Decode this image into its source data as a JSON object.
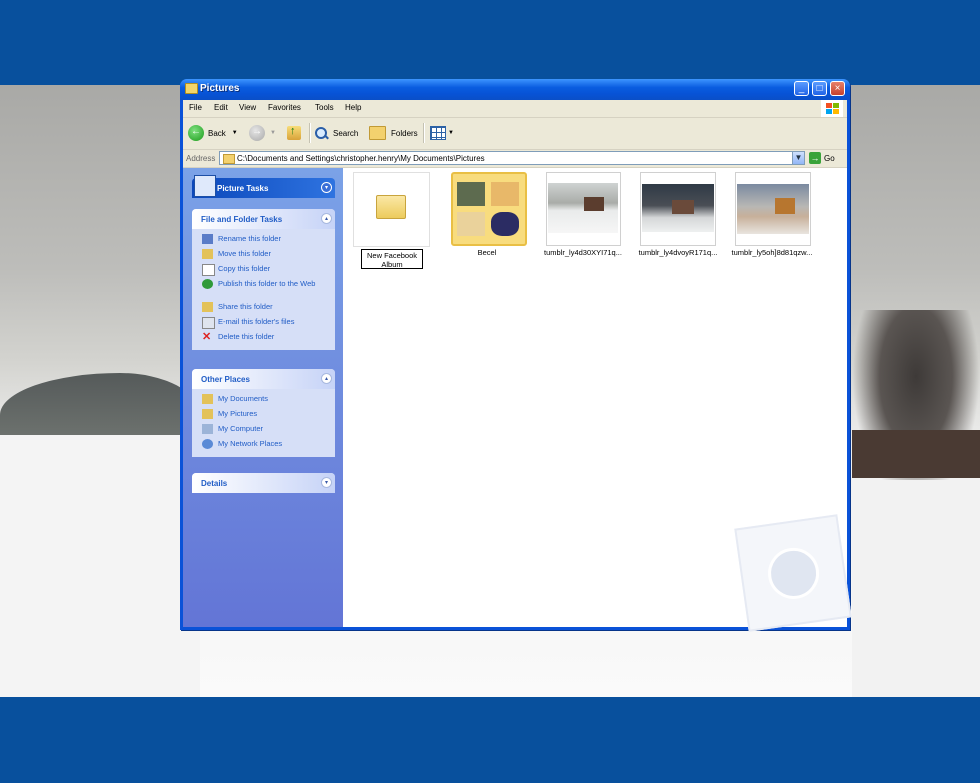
{
  "window": {
    "title": "Pictures",
    "buttons": [
      "_",
      "□",
      "×"
    ]
  },
  "menubar": [
    "File",
    "Edit",
    "View",
    "Favorites",
    "Tools",
    "Help"
  ],
  "toolbar": {
    "back": "Back",
    "search": "Search",
    "folders": "Folders"
  },
  "address": {
    "label": "Address",
    "path": "C:\\Documents and Settings\\christopher.henry\\My Documents\\Pictures",
    "go": "Go"
  },
  "taskpane": {
    "picture_tasks": {
      "title": "Picture Tasks"
    },
    "file_folder_tasks": {
      "title": "File and Folder Tasks",
      "items": [
        "Rename this folder",
        "Move this folder",
        "Copy this folder",
        "Publish this folder to the Web",
        "Share this folder",
        "E-mail this folder's files",
        "Delete this folder"
      ]
    },
    "other_places": {
      "title": "Other Places",
      "items": [
        "My Documents",
        "My Pictures",
        "My Computer",
        "My Network Places"
      ]
    },
    "details": {
      "title": "Details"
    }
  },
  "files": [
    {
      "name": "New Facebook Album",
      "type": "folder",
      "renaming": true
    },
    {
      "name": "Becel",
      "type": "folder",
      "selected": true
    },
    {
      "name": "tumblr_ly4d30XYI71q...",
      "type": "image"
    },
    {
      "name": "tumblr_ly4dvoyR171q...",
      "type": "image"
    },
    {
      "name": "tumblr_ly5oh]8d81qzw...",
      "type": "image"
    }
  ]
}
